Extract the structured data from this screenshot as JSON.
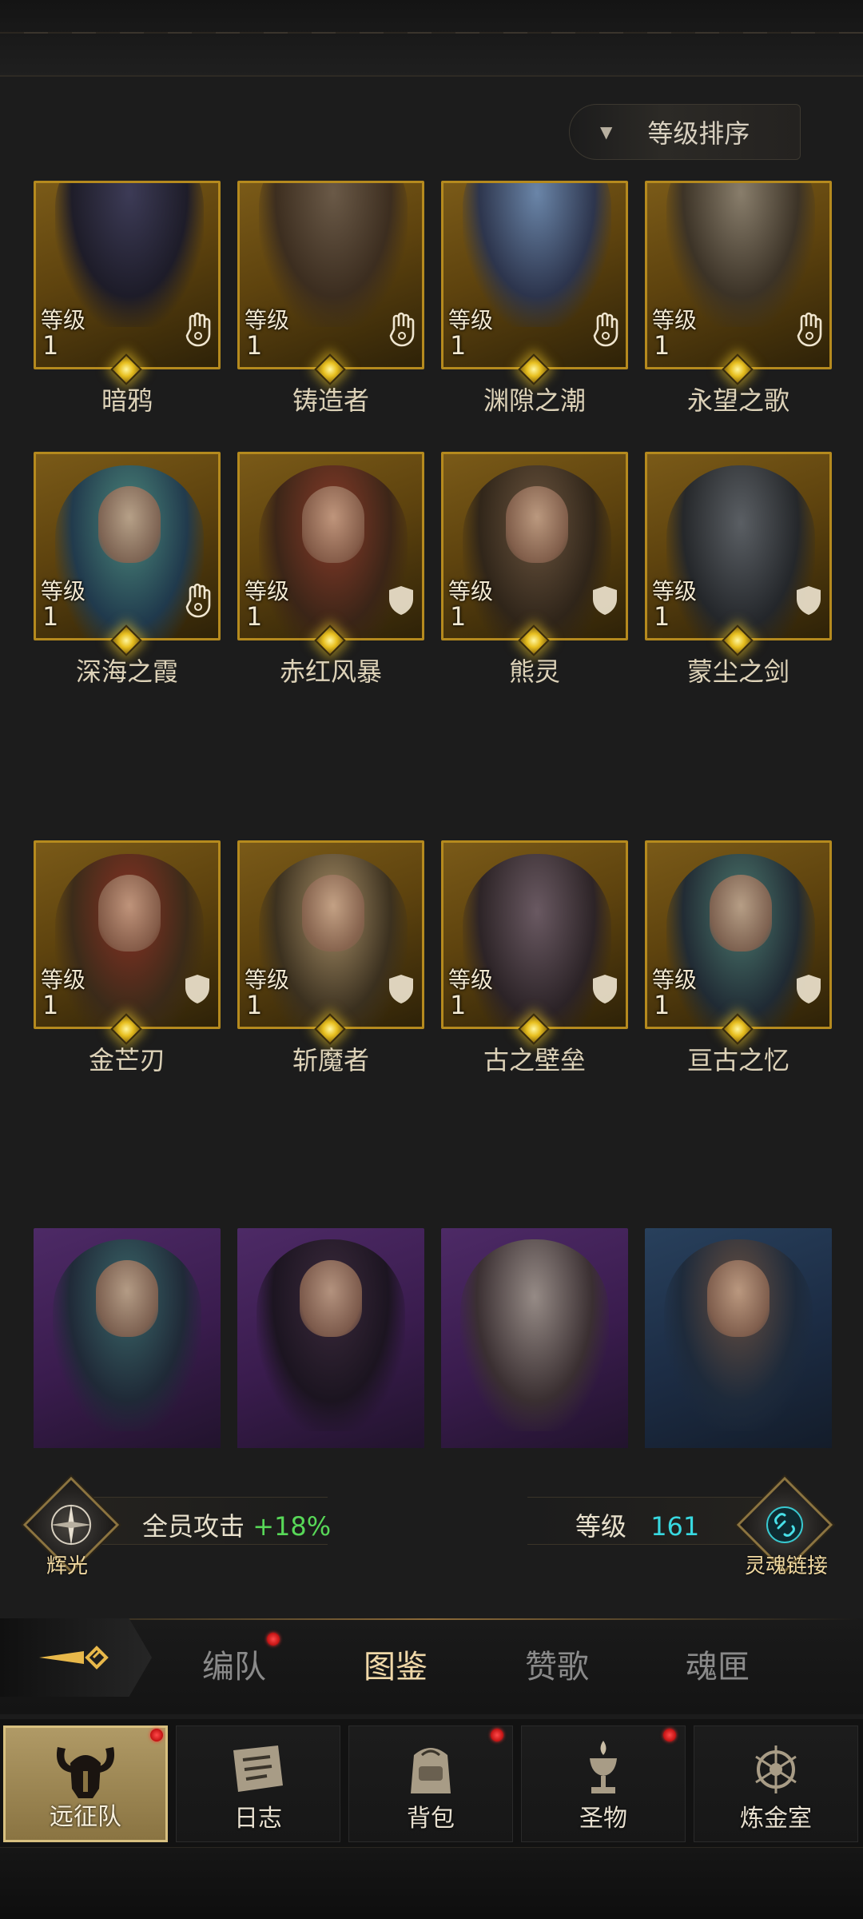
{
  "sort_button": {
    "label": "等级排序",
    "arrow_icon": "triangle-down-icon"
  },
  "level_label": "等级",
  "heroes": [
    {
      "name": "暗鸦",
      "level": "1",
      "frame": "gold",
      "class_icon": "hand-icon"
    },
    {
      "name": "铸造者",
      "level": "1",
      "frame": "gold",
      "class_icon": "hand-icon"
    },
    {
      "name": "渊隙之潮",
      "level": "1",
      "frame": "gold",
      "class_icon": "hand-icon"
    },
    {
      "name": "永望之歌",
      "level": "1",
      "frame": "gold",
      "class_icon": "hand-icon"
    },
    {
      "name": "深海之霞",
      "level": "1",
      "frame": "gold",
      "class_icon": "hand-icon"
    },
    {
      "name": "赤红风暴",
      "level": "1",
      "frame": "gold",
      "class_icon": "shield-icon"
    },
    {
      "name": "熊灵",
      "level": "1",
      "frame": "gold",
      "class_icon": "shield-icon"
    },
    {
      "name": "蒙尘之剑",
      "level": "1",
      "frame": "gold",
      "class_icon": "shield-icon"
    },
    {
      "name": "金芒刃",
      "level": "1",
      "frame": "gold",
      "class_icon": "shield-icon"
    },
    {
      "name": "斩魔者",
      "level": "1",
      "frame": "gold",
      "class_icon": "shield-icon"
    },
    {
      "name": "古之壁垒",
      "level": "1",
      "frame": "gold",
      "class_icon": "shield-icon"
    },
    {
      "name": "亘古之忆",
      "level": "1",
      "frame": "gold",
      "class_icon": "shield-icon"
    },
    {
      "name": "",
      "level": "",
      "frame": "purple",
      "class_icon": ""
    },
    {
      "name": "",
      "level": "",
      "frame": "purple",
      "class_icon": ""
    },
    {
      "name": "",
      "level": "",
      "frame": "purple",
      "class_icon": ""
    },
    {
      "name": "",
      "level": "",
      "frame": "blue",
      "class_icon": ""
    }
  ],
  "stats": {
    "left_emblem_caption": "辉光",
    "team_attack_label": "全员攻击",
    "team_attack_value": "+18%",
    "level_label": "等级",
    "level_value": "161",
    "right_emblem_caption": "灵魂链接"
  },
  "tabs": [
    {
      "label": "编队",
      "has_dot": true
    },
    {
      "label": "图鉴",
      "active": true
    },
    {
      "label": "赞歌"
    },
    {
      "label": "魂匣"
    }
  ],
  "nav": [
    {
      "label": "远征队",
      "icon": "horned-helmet-icon",
      "active": true,
      "has_dot": true
    },
    {
      "label": "日志",
      "icon": "scroll-icon",
      "has_dot": false
    },
    {
      "label": "背包",
      "icon": "backpack-icon",
      "has_dot": true
    },
    {
      "label": "圣物",
      "icon": "chalice-icon",
      "has_dot": true
    },
    {
      "label": "炼金室",
      "icon": "alchemy-icon",
      "has_dot": false
    }
  ],
  "colors": {
    "gold_frame": "#b58a1e",
    "accent_green": "#58d858",
    "accent_cyan": "#38d8e0",
    "notification_red": "#e02020"
  }
}
